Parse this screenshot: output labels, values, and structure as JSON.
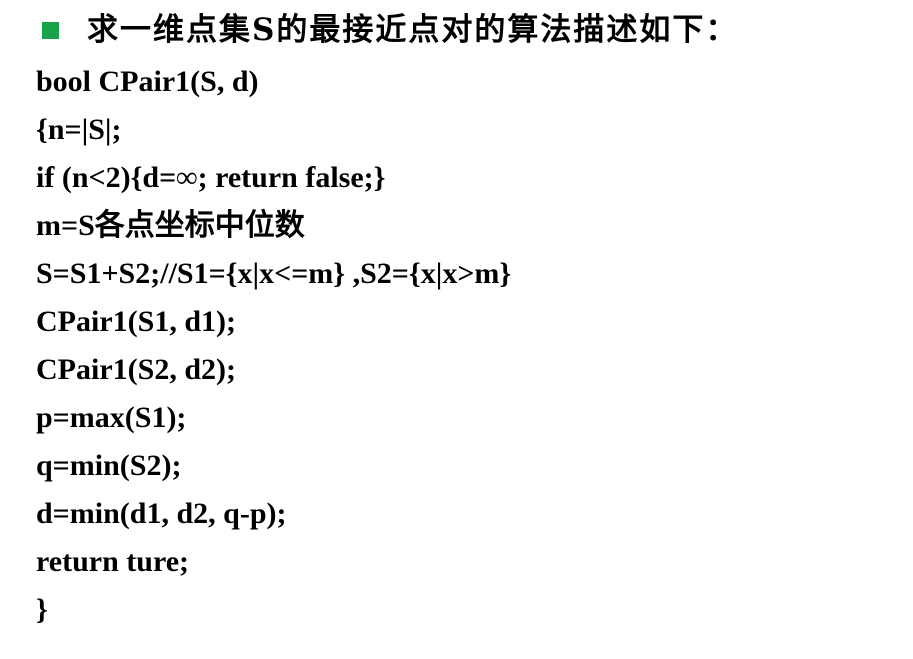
{
  "heading": {
    "text": "求一维点集S的最接近点对的算法描述如下：",
    "bullet_color": "#16a34a"
  },
  "code_lines": [
    "bool CPair1(S, d)",
    "{n=|S|;",
    "if (n<2){d=∞; return false;}",
    "m=S各点坐标中位数",
    "S=S1+S2;//S1={x|x<=m} ,S2={x|x>m}",
    "CPair1(S1, d1);",
    "CPair1(S2, d2);",
    "p=max(S1);",
    "q=min(S2);",
    "d=min(d1, d2, q-p);",
    "return ture;",
    "}"
  ]
}
